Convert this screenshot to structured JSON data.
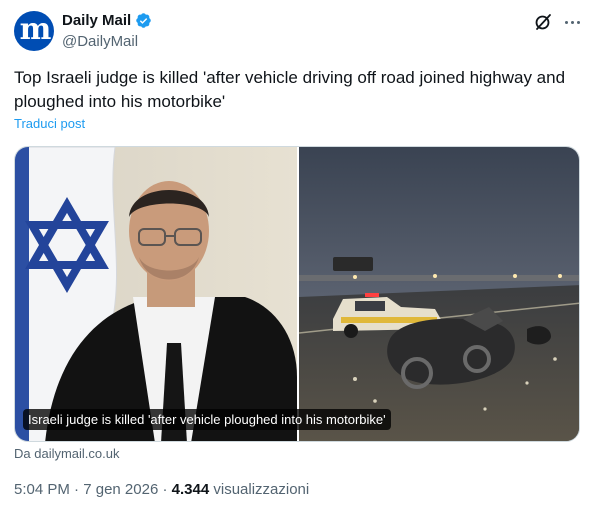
{
  "author": {
    "avatar_glyph": "m",
    "display_name": "Daily Mail",
    "handle": "@DailyMail",
    "verified": true,
    "avatar_color": "#004db3",
    "verified_color": "#1d9bf0"
  },
  "tweet": {
    "text": "Top Israeli judge is killed 'after vehicle driving off road joined highway and ploughed into his motorbike'",
    "translate_label": "Traduci post"
  },
  "card": {
    "caption": "Israeli judge is killed 'after vehicle ploughed into his motorbike'",
    "source_label": "Da dailymail.co.uk"
  },
  "meta": {
    "time": "5:04 PM",
    "separator": "·",
    "date": "7 gen 2026",
    "views_count": "4.344",
    "views_label": "visualizzazioni"
  },
  "icons": {
    "grok": "grok-icon",
    "more": "more-icon",
    "verified": "verified-badge-icon"
  },
  "colors": {
    "link": "#1d9bf0",
    "secondary_text": "#536471",
    "primary_text": "#0f1419"
  }
}
